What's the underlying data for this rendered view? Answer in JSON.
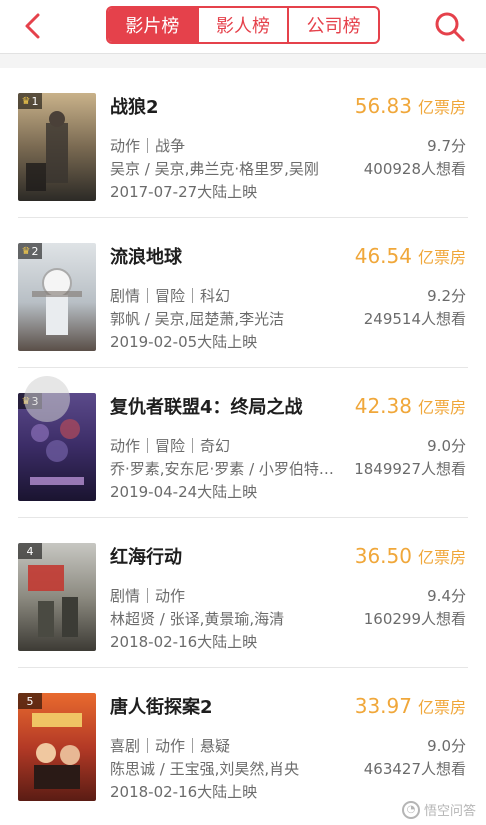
{
  "header": {
    "tabs": [
      {
        "label": "影片榜",
        "active": true
      },
      {
        "label": "影人榜",
        "active": false
      },
      {
        "label": "公司榜",
        "active": false
      }
    ]
  },
  "colors": {
    "accent": "#e5414b",
    "box_office": "#f0a73a"
  },
  "movies": [
    {
      "rank": "1",
      "title": "战狼2",
      "box_office": "56.83",
      "box_unit": "亿票房",
      "genre": "动作｜战争",
      "score": "9.7分",
      "cast": "吴京 / 吴京,弗兰克·格里罗,吴刚",
      "want": "400928人想看",
      "release": "2017-07-27大陆上映"
    },
    {
      "rank": "2",
      "title": "流浪地球",
      "box_office": "46.54",
      "box_unit": "亿票房",
      "genre": "剧情｜冒险｜科幻",
      "score": "9.2分",
      "cast": "郭帆 / 吴京,屈楚萧,李光洁",
      "want": "249514人想看",
      "release": "2019-02-05大陆上映"
    },
    {
      "rank": "3",
      "title": "复仇者联盟4：终局之战",
      "box_office": "42.38",
      "box_unit": "亿票房",
      "genre": "动作｜冒险｜奇幻",
      "score": "9.0分",
      "cast": "乔·罗素,安东尼·罗素 / 小罗伯特·唐尼",
      "want": "1849927人想看",
      "release": "2019-04-24大陆上映"
    },
    {
      "rank": "4",
      "title": "红海行动",
      "box_office": "36.50",
      "box_unit": "亿票房",
      "genre": "剧情｜动作",
      "score": "9.4分",
      "cast": "林超贤 / 张译,黄景瑜,海清",
      "want": "160299人想看",
      "release": "2018-02-16大陆上映"
    },
    {
      "rank": "5",
      "title": "唐人街探案2",
      "box_office": "33.97",
      "box_unit": "亿票房",
      "genre": "喜剧｜动作｜悬疑",
      "score": "9.0分",
      "cast": "陈思诚 / 王宝强,刘昊然,肖央",
      "want": "463427人想看",
      "release": "2018-02-16大陆上映"
    }
  ],
  "watermark": {
    "text": "悟空问答"
  }
}
